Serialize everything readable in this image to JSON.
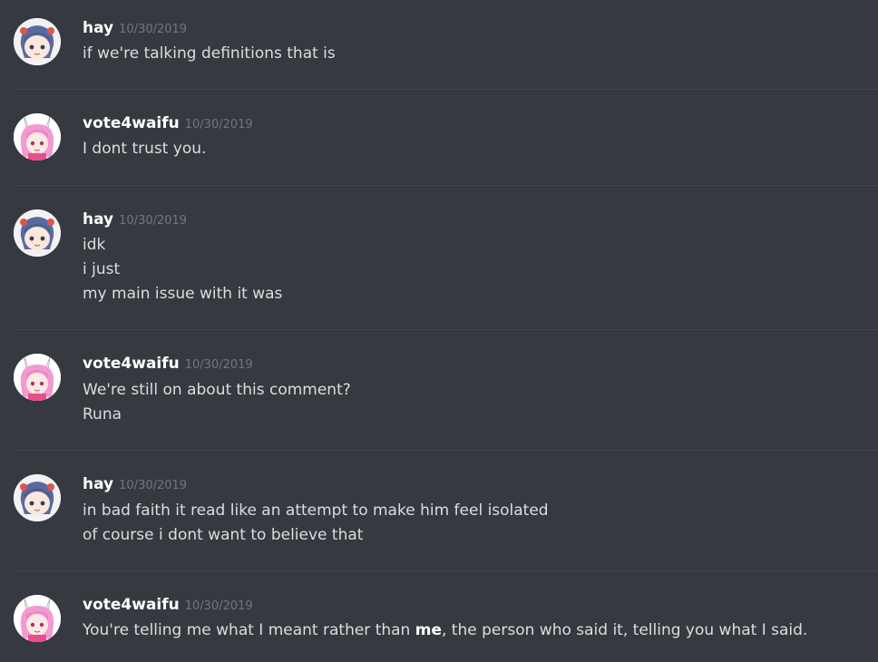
{
  "messages": [
    {
      "author": "hay",
      "avatar": "hay-avatar",
      "timestamp": "10/30/2019",
      "lines": [
        "if we're talking definitions that is"
      ]
    },
    {
      "author": "vote4waifu",
      "avatar": "vote4waifu-avatar",
      "timestamp": "10/30/2019",
      "lines": [
        "I dont trust you."
      ]
    },
    {
      "author": "hay",
      "avatar": "hay-avatar",
      "timestamp": "10/30/2019",
      "lines": [
        "idk",
        "i just",
        "my main issue with it was"
      ]
    },
    {
      "author": "vote4waifu",
      "avatar": "vote4waifu-avatar",
      "timestamp": "10/30/2019",
      "lines": [
        "We're still on about this comment?",
        "Runa"
      ]
    },
    {
      "author": "hay",
      "avatar": "hay-avatar",
      "timestamp": "10/30/2019",
      "lines": [
        "in bad faith it read like an attempt to make him feel isolated",
        "of course i dont want to believe that"
      ]
    },
    {
      "author": "vote4waifu",
      "avatar": "vote4waifu-avatar",
      "timestamp": "10/30/2019",
      "line_parts": {
        "before": "You're telling me what I meant rather than ",
        "bold": "me",
        "after": ", the person who said it, telling you what I said."
      }
    }
  ],
  "colors": {
    "background": "#36393f",
    "username": "#ffffff",
    "timestamp": "#72767d",
    "text": "#dcddde",
    "divider": "#42454a"
  }
}
